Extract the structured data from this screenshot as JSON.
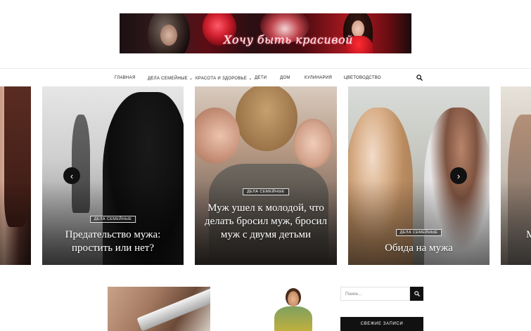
{
  "header": {
    "banner_text": "Хочу быть красивой"
  },
  "nav": {
    "items": [
      {
        "label": "Главная",
        "has_submenu": false
      },
      {
        "label": "Дела семейные",
        "has_submenu": true
      },
      {
        "label": "Красота и здоровье",
        "has_submenu": true
      },
      {
        "label": "Дети",
        "has_submenu": false
      },
      {
        "label": "Дом",
        "has_submenu": false
      },
      {
        "label": "Кулинария",
        "has_submenu": false
      },
      {
        "label": "Цветоводство",
        "has_submenu": false
      }
    ],
    "search_icon": "search-icon"
  },
  "slider": {
    "prev_icon": "‹",
    "next_icon": "›",
    "slides": [
      {
        "category": "",
        "title": "те"
      },
      {
        "category": "Дела семейные",
        "title": "Предательство мужа: простить или нет?"
      },
      {
        "category": "Дела семейные",
        "title": "Муж ушел к молодой, что делать бросил муж, бросил муж с двумя детьми"
      },
      {
        "category": "Дела семейные",
        "title": "Обида на мужа"
      },
      {
        "category": "",
        "title": "М"
      }
    ]
  },
  "sidebar": {
    "search_placeholder": "Поиск...",
    "recent_title": "Свежие записи"
  },
  "colors": {
    "accent": "#111111",
    "text": "#1d1d1d"
  }
}
